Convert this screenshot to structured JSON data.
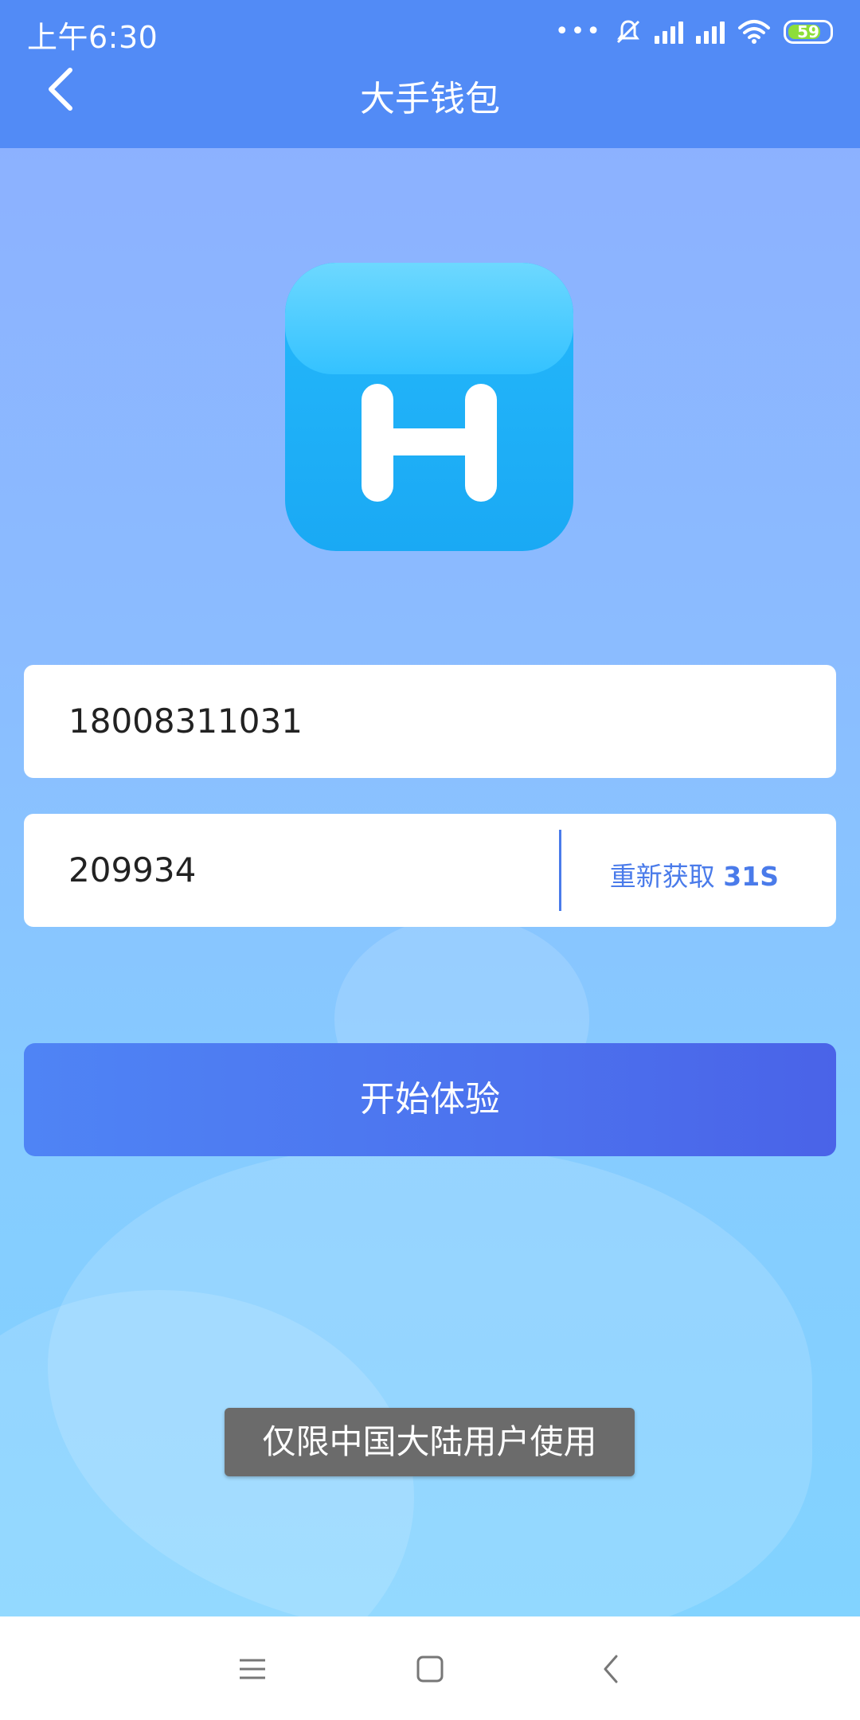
{
  "status_bar": {
    "time": "上午6:30",
    "battery": "59"
  },
  "header": {
    "title": "大手钱包"
  },
  "form": {
    "phone_value": "18008311031",
    "code_value": "209934",
    "resend_label": "重新获取",
    "resend_countdown": "31S"
  },
  "cta": {
    "label": "开始体验"
  },
  "toast": {
    "text": "仅限中国大陆用户使用"
  },
  "icons": [
    "back-icon",
    "app-logo-icon",
    "signal-icon",
    "wifi-icon",
    "battery-icon",
    "mute-icon",
    "menu-icon",
    "home-icon",
    "nav-back-icon"
  ],
  "colors": {
    "header": "#528bf6",
    "accent": "#4a7bea",
    "cta_start": "#4f84f5",
    "cta_end": "#4a63e8"
  }
}
